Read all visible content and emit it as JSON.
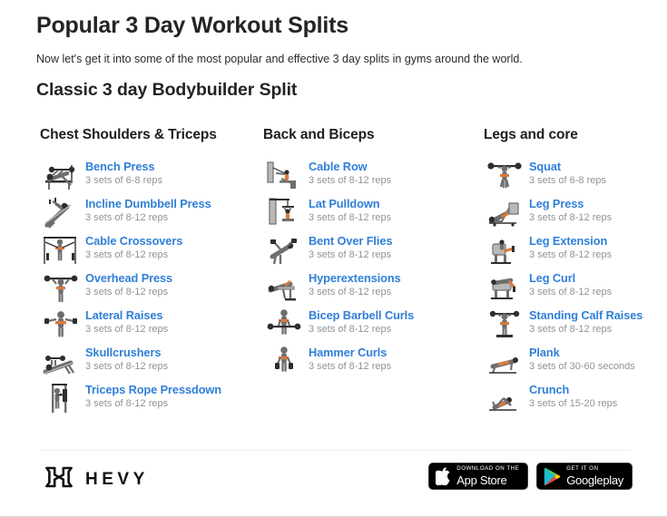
{
  "header": {
    "title": "Popular 3 Day Workout Splits",
    "intro": "Now let's get it into some of the most popular and effective 3 day splits in gyms around the world.",
    "subtitle": "Classic 3 day Bodybuilder Split"
  },
  "colors": {
    "link_blue": "#2f7fd8",
    "muted_gray": "#8e9399",
    "heading": "#242424",
    "divider": "#ececec"
  },
  "columns": [
    {
      "heading": "Chest Shoulders & Triceps",
      "exercises": [
        {
          "name": "Bench Press",
          "sets": "3 sets of 6-8 reps",
          "icon": "bench-press-icon"
        },
        {
          "name": "Incline Dumbbell Press",
          "sets": "3 sets of 8-12 reps",
          "icon": "incline-dumbbell-press-icon"
        },
        {
          "name": "Cable Crossovers",
          "sets": "3 sets of 8-12 reps",
          "icon": "cable-crossovers-icon"
        },
        {
          "name": "Overhead Press",
          "sets": "3 sets of 8-12 reps",
          "icon": "overhead-press-icon"
        },
        {
          "name": "Lateral Raises",
          "sets": "3 sets of 8-12 reps",
          "icon": "lateral-raises-icon"
        },
        {
          "name": "Skullcrushers",
          "sets": "3 sets of 8-12 reps",
          "icon": "skullcrushers-icon"
        },
        {
          "name": "Triceps Rope Pressdown",
          "sets": "3 sets of 8-12 reps",
          "icon": "triceps-rope-pressdown-icon"
        }
      ]
    },
    {
      "heading": "Back and Biceps",
      "exercises": [
        {
          "name": "Cable Row",
          "sets": "3 sets of 8-12 reps",
          "icon": "cable-row-icon"
        },
        {
          "name": "Lat Pulldown",
          "sets": "3 sets of 8-12 reps",
          "icon": "lat-pulldown-icon"
        },
        {
          "name": "Bent Over Flies",
          "sets": "3 sets of 8-12 reps",
          "icon": "bent-over-flies-icon"
        },
        {
          "name": "Hyperextensions",
          "sets": "3 sets of 8-12 reps",
          "icon": "hyperextensions-icon"
        },
        {
          "name": "Bicep Barbell Curls",
          "sets": "3 sets of 8-12 reps",
          "icon": "bicep-barbell-curls-icon"
        },
        {
          "name": "Hammer Curls",
          "sets": "3 sets of 8-12 reps",
          "icon": "hammer-curls-icon"
        }
      ]
    },
    {
      "heading": "Legs and core",
      "exercises": [
        {
          "name": "Squat",
          "sets": "3 sets of 6-8 reps",
          "icon": "squat-icon"
        },
        {
          "name": "Leg Press",
          "sets": "3 sets of 8-12 reps",
          "icon": "leg-press-icon"
        },
        {
          "name": "Leg Extension",
          "sets": "3 sets of 8-12 reps",
          "icon": "leg-extension-icon"
        },
        {
          "name": "Leg Curl",
          "sets": "3 sets of 8-12 reps",
          "icon": "leg-curl-icon"
        },
        {
          "name": "Standing Calf Raises",
          "sets": "3 sets of 8-12 reps",
          "icon": "standing-calf-raises-icon"
        },
        {
          "name": "Plank",
          "sets": "3 sets of 30-60 seconds",
          "icon": "plank-icon"
        },
        {
          "name": "Crunch",
          "sets": "3 sets of 15-20 reps",
          "icon": "crunch-icon"
        }
      ]
    }
  ],
  "footer": {
    "brand_name": "HEVY",
    "brand_logo_icon": "hevy-logo-icon",
    "badges": [
      {
        "icon": "apple-logo-icon",
        "small_text": "Download on the",
        "big_text": "App Store"
      },
      {
        "icon": "google-play-icon",
        "small_text": "GET IT ON",
        "big_text": "Google",
        "big_text_thin": "play"
      }
    ]
  }
}
